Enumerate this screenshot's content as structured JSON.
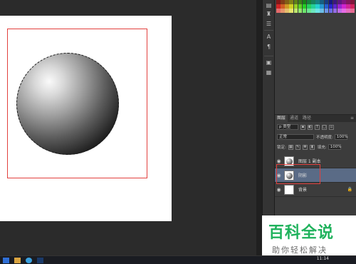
{
  "layers_panel": {
    "tabs": [
      "图层",
      "通道",
      "路径"
    ],
    "filter_kind": "p 类型",
    "blend_mode": "正常",
    "opacity_label": "不透明度:",
    "opacity_value": "100%",
    "lock_label": "锁定:",
    "fill_label": "填充:",
    "fill_value": "100%",
    "layers": [
      {
        "name": "图层 1 副本",
        "visible": true,
        "selected": false
      },
      {
        "name": "阴影",
        "visible": true,
        "selected": true
      },
      {
        "name": "背景",
        "visible": true,
        "selected": false,
        "locked": true
      }
    ]
  },
  "watermark": {
    "title": "百科全说",
    "subtitle": "助你轻松解决"
  },
  "taskbar": {
    "time": "11:14"
  },
  "colors": {
    "selection_box": "#e2403d",
    "selected_layer": "#5a6b86",
    "watermark_green": "#1fb25c"
  },
  "icons": {
    "tool_icons": [
      "properties-icon",
      "paint-bucket-icon",
      "adjust-sliders-icon",
      "character-icon",
      "paragraph-icon",
      "layer-comps-icon",
      "notes-icon"
    ],
    "taskbar_icons": [
      "windows-start-icon",
      "folder-icon",
      "browser-icon",
      "photoshop-icon"
    ]
  }
}
